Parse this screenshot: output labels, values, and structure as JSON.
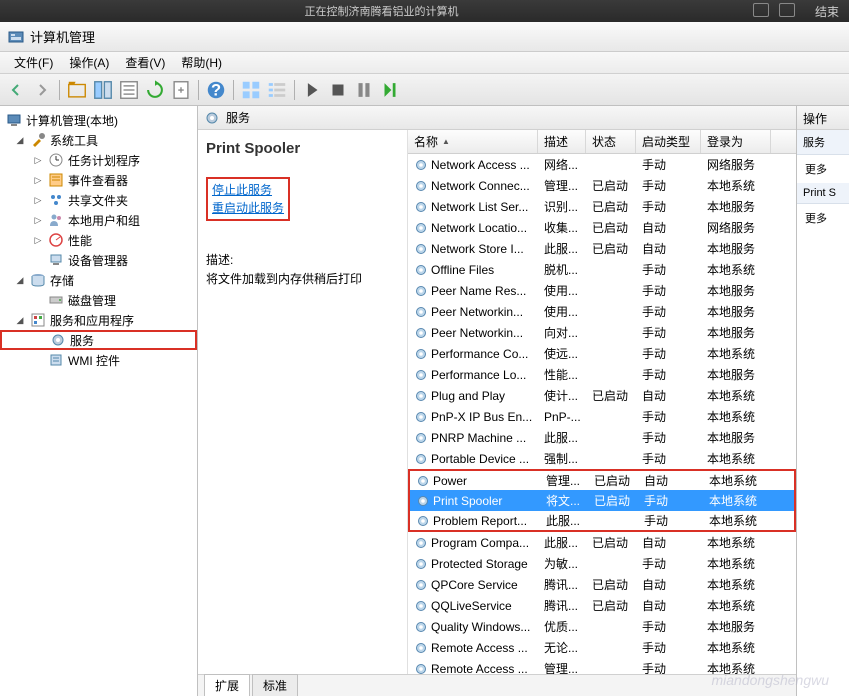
{
  "top_bar": {
    "message": "正在控制济南腾看铝业的计算机",
    "right_label": "结束"
  },
  "window": {
    "title": "计算机管理"
  },
  "menu": {
    "file": "文件(F)",
    "action": "操作(A)",
    "view": "查看(V)",
    "help": "帮助(H)"
  },
  "tree": {
    "root": "计算机管理(本地)",
    "system_tools": "系统工具",
    "task_scheduler": "任务计划程序",
    "event_viewer": "事件查看器",
    "shared_folders": "共享文件夹",
    "local_users": "本地用户和组",
    "performance": "性能",
    "device_manager": "设备管理器",
    "storage": "存储",
    "disk_management": "磁盘管理",
    "services_apps": "服务和应用程序",
    "services": "服务",
    "wmi": "WMI 控件"
  },
  "center": {
    "header": "服务"
  },
  "detail": {
    "title": "Print Spooler",
    "stop_link": "停止此服务",
    "restart_link": "重启动此服务",
    "desc_label": "描述:",
    "desc_text": "将文件加载到内存供稍后打印"
  },
  "columns": {
    "name": "名称",
    "desc": "描述",
    "status": "状态",
    "startup": "启动类型",
    "logon": "登录为"
  },
  "services_list": [
    {
      "name": "Network Access ...",
      "desc": "网络...",
      "status": "",
      "startup": "手动",
      "logon": "网络服务"
    },
    {
      "name": "Network Connec...",
      "desc": "管理...",
      "status": "已启动",
      "startup": "手动",
      "logon": "本地系统"
    },
    {
      "name": "Network List Ser...",
      "desc": "识别...",
      "status": "已启动",
      "startup": "手动",
      "logon": "本地服务"
    },
    {
      "name": "Network Locatio...",
      "desc": "收集...",
      "status": "已启动",
      "startup": "自动",
      "logon": "网络服务"
    },
    {
      "name": "Network Store I...",
      "desc": "此服...",
      "status": "已启动",
      "startup": "自动",
      "logon": "本地服务"
    },
    {
      "name": "Offline Files",
      "desc": "脱机...",
      "status": "",
      "startup": "手动",
      "logon": "本地系统"
    },
    {
      "name": "Peer Name Res...",
      "desc": "使用...",
      "status": "",
      "startup": "手动",
      "logon": "本地服务"
    },
    {
      "name": "Peer Networkin...",
      "desc": "使用...",
      "status": "",
      "startup": "手动",
      "logon": "本地服务"
    },
    {
      "name": "Peer Networkin...",
      "desc": "向对...",
      "status": "",
      "startup": "手动",
      "logon": "本地服务"
    },
    {
      "name": "Performance Co...",
      "desc": "使远...",
      "status": "",
      "startup": "手动",
      "logon": "本地系统"
    },
    {
      "name": "Performance Lo...",
      "desc": "性能...",
      "status": "",
      "startup": "手动",
      "logon": "本地服务"
    },
    {
      "name": "Plug and Play",
      "desc": "使计...",
      "status": "已启动",
      "startup": "自动",
      "logon": "本地系统"
    },
    {
      "name": "PnP-X IP Bus En...",
      "desc": "PnP-...",
      "status": "",
      "startup": "手动",
      "logon": "本地系统"
    },
    {
      "name": "PNRP Machine ...",
      "desc": "此服...",
      "status": "",
      "startup": "手动",
      "logon": "本地服务"
    },
    {
      "name": "Portable Device ...",
      "desc": "强制...",
      "status": "",
      "startup": "手动",
      "logon": "本地系统"
    },
    {
      "name": "Power",
      "desc": "管理...",
      "status": "已启动",
      "startup": "自动",
      "logon": "本地系统",
      "box": "top"
    },
    {
      "name": "Print Spooler",
      "desc": "将文...",
      "status": "已启动",
      "startup": "手动",
      "logon": "本地系统",
      "selected": true,
      "box": "mid"
    },
    {
      "name": "Problem Report...",
      "desc": "此服...",
      "status": "",
      "startup": "手动",
      "logon": "本地系统",
      "box": "bot"
    },
    {
      "name": "Program Compa...",
      "desc": "此服...",
      "status": "已启动",
      "startup": "自动",
      "logon": "本地系统"
    },
    {
      "name": "Protected Storage",
      "desc": "为敏...",
      "status": "",
      "startup": "手动",
      "logon": "本地系统"
    },
    {
      "name": "QPCore Service",
      "desc": "腾讯...",
      "status": "已启动",
      "startup": "自动",
      "logon": "本地系统"
    },
    {
      "name": "QQLiveService",
      "desc": "腾讯...",
      "status": "已启动",
      "startup": "自动",
      "logon": "本地系统"
    },
    {
      "name": "Quality Windows...",
      "desc": "优质...",
      "status": "",
      "startup": "手动",
      "logon": "本地服务"
    },
    {
      "name": "Remote Access ...",
      "desc": "无论...",
      "status": "",
      "startup": "手动",
      "logon": "本地系统"
    },
    {
      "name": "Remote Access ...",
      "desc": "管理...",
      "status": "",
      "startup": "手动",
      "logon": "本地系统"
    }
  ],
  "tabs": {
    "extended": "扩展",
    "standard": "标准"
  },
  "right": {
    "header": "操作",
    "section1": "服务",
    "more1": "更多",
    "section2": "Print S",
    "more2": "更多"
  },
  "watermark": "miandongshengwu"
}
